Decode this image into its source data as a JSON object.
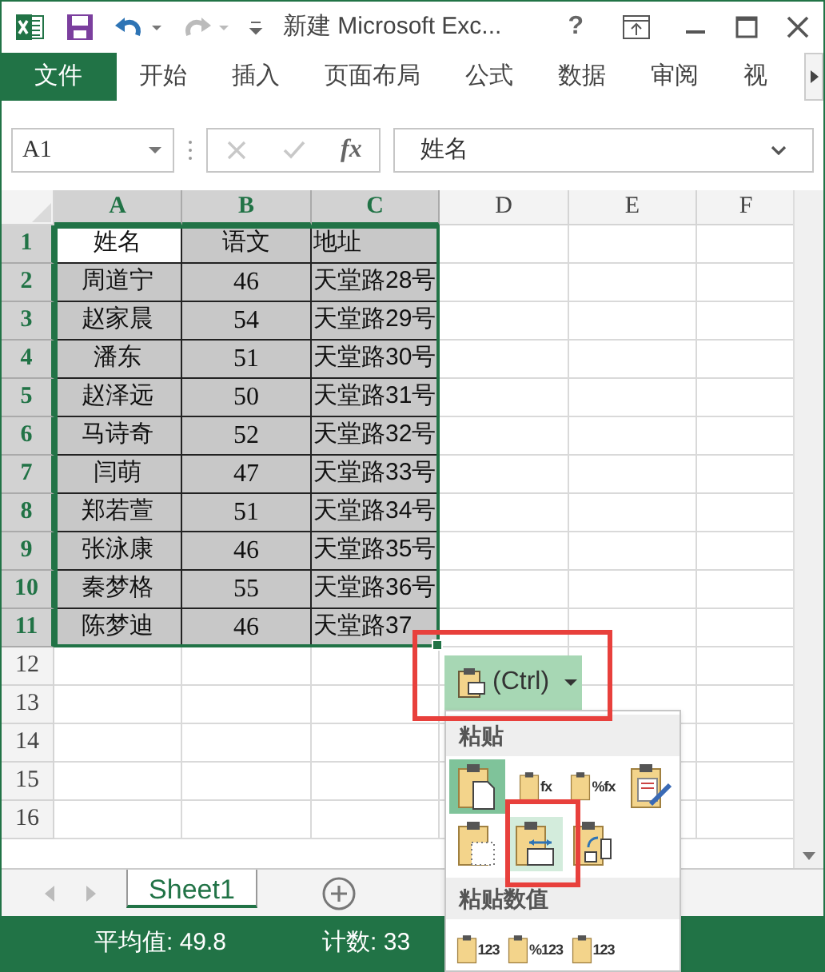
{
  "window": {
    "title": "新建 Microsoft Exc...",
    "help": "?"
  },
  "ribbon_tabs": [
    {
      "label": "文件",
      "kind": "file",
      "selected": false
    },
    {
      "label": "开始",
      "kind": "tab",
      "selected": false
    },
    {
      "label": "插入",
      "kind": "tab",
      "selected": false
    },
    {
      "label": "页面布局",
      "kind": "tab",
      "selected": false
    },
    {
      "label": "公式",
      "kind": "tab",
      "selected": false
    },
    {
      "label": "数据",
      "kind": "tab",
      "selected": false
    },
    {
      "label": "审阅",
      "kind": "tab",
      "selected": false
    },
    {
      "label": "视",
      "kind": "tab",
      "selected": false
    }
  ],
  "formula_bar": {
    "name_box": "A1",
    "fx": "fx",
    "value": "姓名"
  },
  "sheet": {
    "columns": [
      {
        "label": "A",
        "selected": true
      },
      {
        "label": "B",
        "selected": true
      },
      {
        "label": "C",
        "selected": true
      },
      {
        "label": "D",
        "selected": false
      },
      {
        "label": "E",
        "selected": false
      },
      {
        "label": "F",
        "selected": false
      }
    ],
    "rows": [
      {
        "label": "1",
        "selected": true,
        "cells": [
          "姓名",
          "语文",
          "地址"
        ]
      },
      {
        "label": "2",
        "selected": true,
        "cells": [
          "周道宁",
          "46",
          "天堂路28号"
        ]
      },
      {
        "label": "3",
        "selected": true,
        "cells": [
          "赵家晨",
          "54",
          "天堂路29号"
        ]
      },
      {
        "label": "4",
        "selected": true,
        "cells": [
          "潘东",
          "51",
          "天堂路30号"
        ]
      },
      {
        "label": "5",
        "selected": true,
        "cells": [
          "赵泽远",
          "50",
          "天堂路31号"
        ]
      },
      {
        "label": "6",
        "selected": true,
        "cells": [
          "马诗奇",
          "52",
          "天堂路32号"
        ]
      },
      {
        "label": "7",
        "selected": true,
        "cells": [
          "闫萌",
          "47",
          "天堂路33号"
        ]
      },
      {
        "label": "8",
        "selected": true,
        "cells": [
          "郑若萱",
          "51",
          "天堂路34号"
        ]
      },
      {
        "label": "9",
        "selected": true,
        "cells": [
          "张泳康",
          "46",
          "天堂路35号"
        ]
      },
      {
        "label": "10",
        "selected": true,
        "cells": [
          "秦梦格",
          "55",
          "天堂路36号"
        ]
      },
      {
        "label": "11",
        "selected": true,
        "cells": [
          "陈梦迪",
          "46",
          "天堂路37"
        ]
      },
      {
        "label": "12",
        "selected": false,
        "cells": []
      },
      {
        "label": "13",
        "selected": false,
        "cells": []
      },
      {
        "label": "14",
        "selected": false,
        "cells": []
      },
      {
        "label": "15",
        "selected": false,
        "cells": []
      },
      {
        "label": "16",
        "selected": false,
        "cells": []
      }
    ]
  },
  "paste_button": {
    "label": "(Ctrl)"
  },
  "paste_menu": {
    "sections": [
      {
        "title": "粘贴",
        "options": [
          {
            "kind": "paste",
            "selected": true,
            "hovered": false
          },
          {
            "kind": "glyph",
            "glyph": "fx",
            "selected": false,
            "hovered": false
          },
          {
            "kind": "glyph",
            "glyph": "%fx",
            "selected": false,
            "hovered": false
          },
          {
            "kind": "brush",
            "selected": false,
            "hovered": false
          },
          {
            "kind": "no-borders",
            "selected": false,
            "hovered": false
          },
          {
            "kind": "widths",
            "selected": false,
            "hovered": true
          },
          {
            "kind": "transpose",
            "selected": false,
            "hovered": false
          }
        ]
      },
      {
        "title": "粘贴数值",
        "options": [
          {
            "kind": "glyph",
            "glyph": "123",
            "selected": false,
            "hovered": false
          },
          {
            "kind": "glyph",
            "glyph": "%123",
            "selected": false,
            "hovered": false
          },
          {
            "kind": "glyph",
            "glyph": "123",
            "selected": false,
            "hovered": false
          }
        ]
      }
    ]
  },
  "sheet_tabs": [
    {
      "label": "Sheet1",
      "selected": true
    }
  ],
  "status_bar": {
    "average": "平均值: 49.8",
    "count": "计数: 33"
  }
}
